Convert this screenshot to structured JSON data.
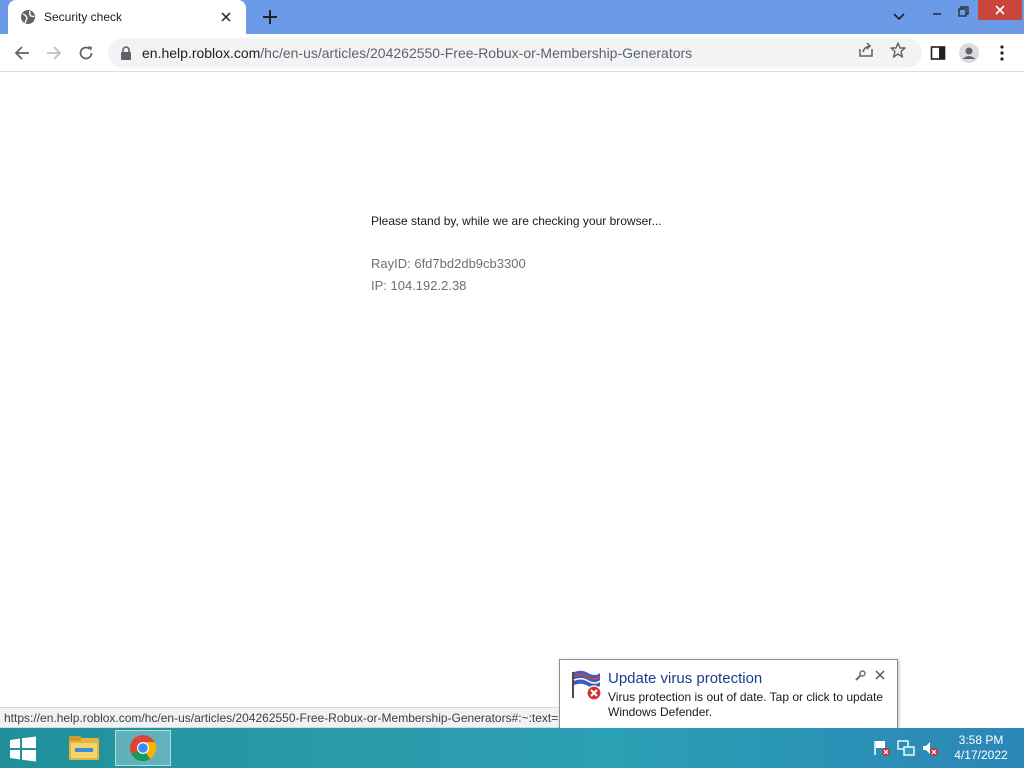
{
  "browser": {
    "tab_title": "Security check",
    "url_host": "en.help.roblox.com",
    "url_path": "/hc/en-us/articles/204262550-Free-Robux-or-Membership-Generators"
  },
  "page": {
    "standby_text": "Please stand by, while we are checking your browser...",
    "ray_id": "RayID: 6fd7bd2db9cb3300",
    "ip": "IP: 104.192.2.38"
  },
  "status_bar": {
    "link": "https://en.help.roblox.com/hc/en-us/articles/204262550-Free-Robux-or-Membership-Generators#:~:text=..."
  },
  "notification": {
    "title": "Update virus protection",
    "message": "Virus protection is out of date. Tap or click to update Windows Defender.",
    "icon": "defender-flag-error-icon"
  },
  "taskbar": {
    "apps": [
      "file-explorer-icon",
      "chrome-icon"
    ],
    "time": "3:58 PM",
    "date": "4/17/2022"
  },
  "colors": {
    "tabstrip": "#6b9ae6",
    "window_close": "#c9463d",
    "notification_title": "#1e3b8f"
  }
}
